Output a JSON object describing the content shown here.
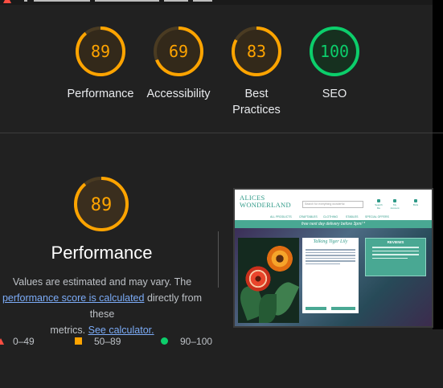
{
  "summary_gauges": [
    {
      "score": "89",
      "label": "Performance",
      "color": "#ffa400",
      "fraction": 0.89
    },
    {
      "score": "69",
      "label": "Accessibility",
      "color": "#ffa400",
      "fraction": 0.69
    },
    {
      "score": "83",
      "label": "Best Practices",
      "color": "#ffa400",
      "fraction": 0.83
    },
    {
      "score": "100",
      "label": "SEO",
      "color": "#0cce6b",
      "fraction": 1.0
    }
  ],
  "performance": {
    "score": "89",
    "fraction": 0.89,
    "title": "Performance",
    "desc_line1": "Values are estimated and may vary. The",
    "desc_link": "performance score is calculated",
    "desc_line2": " directly from these",
    "desc_line3_pre": "metrics. ",
    "desc_link2": "See calculator."
  },
  "legend": {
    "fail": "0–49",
    "average": "50–89",
    "pass": "90–100"
  },
  "screenshot": {
    "logo_line1": "ALICES",
    "logo_line2": "WONDERLAND",
    "search_placeholder": "Search for everything wonderful",
    "icons": [
      "Search Me",
      "My Account",
      "BAG"
    ],
    "nav": [
      "ALL PRODUCTS",
      "CRAFTABLES",
      "CLOTHING",
      "STABLES",
      "SPECIAL OFFERS"
    ],
    "banner": "free next day delivery before 3pm! *",
    "product_title": "Talking Tiger Lily",
    "reviews_title": "REVIEWS"
  },
  "colors": {
    "average": "#ffa400",
    "pass": "#0cce6b",
    "fail": "#ff4e42"
  }
}
